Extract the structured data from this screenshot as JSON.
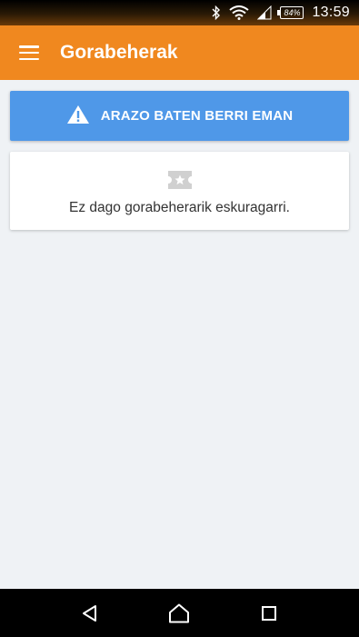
{
  "status_bar": {
    "battery_percent": "84%",
    "time": "13:59",
    "icons": [
      "bluetooth-icon",
      "wifi-icon",
      "signal-icon",
      "battery-icon"
    ]
  },
  "app_bar": {
    "title": "Gorabeherak",
    "menu_icon": "hamburger-menu-icon",
    "background_color": "#f0881f"
  },
  "report_button": {
    "label": "ARAZO BATEN BERRI EMAN",
    "icon": "warning-icon",
    "background_color": "#4f98e8"
  },
  "empty_state": {
    "icon": "ticket-icon",
    "message": "Ez dago gorabeherarik eskuragarri."
  },
  "nav_bar": {
    "buttons": [
      "back-icon",
      "home-icon",
      "recents-icon"
    ]
  }
}
